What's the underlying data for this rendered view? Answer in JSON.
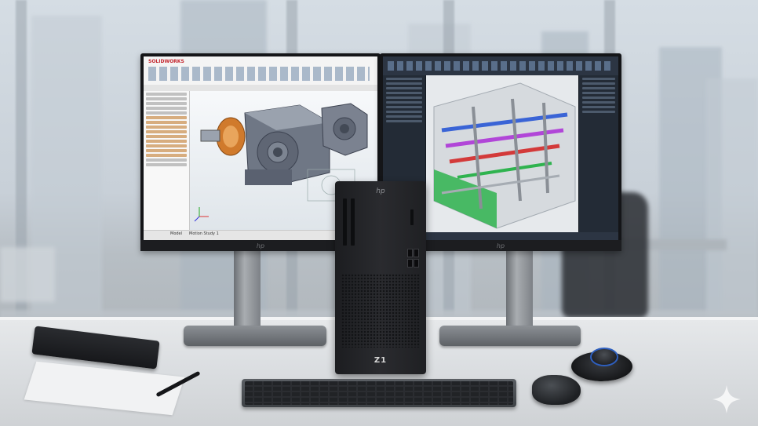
{
  "left_monitor": {
    "brand_text": "hp",
    "app_name": "SOLIDWORKS",
    "view_tabs": [
      "Model",
      "Motion Study 1"
    ]
  },
  "right_monitor": {
    "brand_text": "hp"
  },
  "tower": {
    "brand_text": "hp",
    "model_label": "Z1"
  },
  "colors": {
    "cad_orange": "#d07a2c",
    "pipe_red": "#d33a3a",
    "pipe_green": "#2fb34f",
    "pipe_blue": "#3a64d6",
    "pipe_purple": "#b146d8",
    "accent_blue": "#2e5fbf"
  },
  "icons": {
    "watermark": "sparkle-icon"
  }
}
